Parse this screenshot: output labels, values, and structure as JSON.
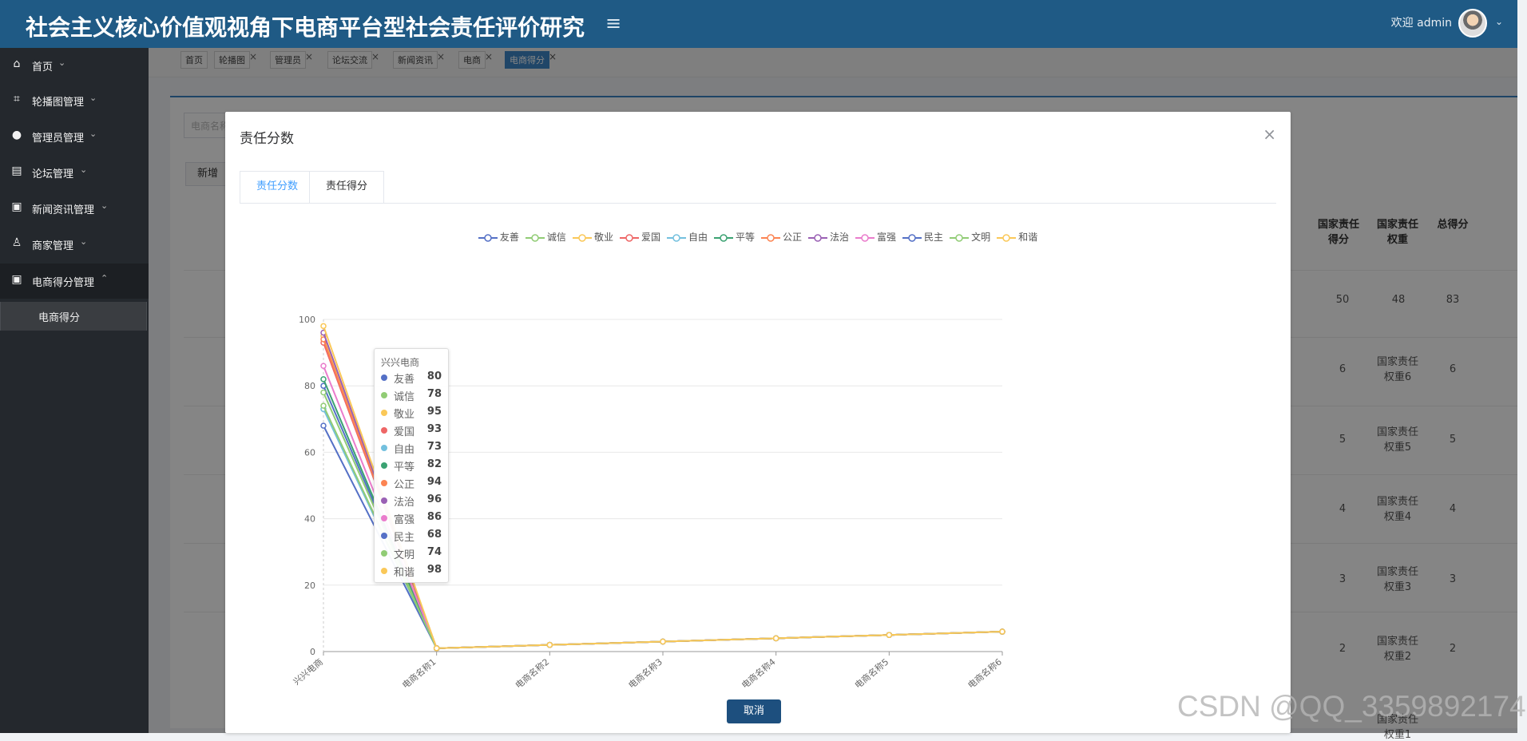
{
  "header": {
    "title": "社会主义核心价值观视角下电商平台型社会责任评价研究",
    "welcome": "欢迎 admin"
  },
  "sidebar": {
    "items": [
      {
        "label": "首页"
      },
      {
        "label": "轮播图管理"
      },
      {
        "label": "管理员管理"
      },
      {
        "label": "论坛管理"
      },
      {
        "label": "新闻资讯管理"
      },
      {
        "label": "商家管理"
      },
      {
        "label": "电商得分管理"
      }
    ],
    "subitem": "电商得分"
  },
  "tabs": [
    {
      "label": "首页"
    },
    {
      "label": "轮播图"
    },
    {
      "label": "管理员"
    },
    {
      "label": "论坛交流"
    },
    {
      "label": "新闻资讯"
    },
    {
      "label": "电商"
    },
    {
      "label": "电商得分"
    }
  ],
  "background": {
    "search_placeholder": "电商名称",
    "new_button": "新增",
    "headers": [
      "国家责任得分",
      "国家责任权重",
      "总得分"
    ],
    "rows": [
      {
        "score": "50",
        "weight": "48",
        "total": "83"
      },
      {
        "score": "6",
        "weight": "国家责任权重6",
        "total": "6"
      },
      {
        "score": "5",
        "weight": "国家责任权重5",
        "total": "5"
      },
      {
        "score": "4",
        "weight": "国家责任权重4",
        "total": "4"
      },
      {
        "score": "3",
        "weight": "国家责任权重3",
        "total": "3"
      },
      {
        "score": "2",
        "weight": "国家责任权重2",
        "total": "2"
      },
      {
        "score": "",
        "weight": "国家责任权重1",
        "total": ""
      }
    ]
  },
  "dialog": {
    "title": "责任分数",
    "tabs": [
      "责任分数",
      "责任得分"
    ],
    "cancel": "取消"
  },
  "tooltip": {
    "title": "兴兴电商",
    "rows": [
      {
        "name": "友善",
        "value": "80",
        "color": "#5470c6"
      },
      {
        "name": "诚信",
        "value": "78",
        "color": "#91cc75"
      },
      {
        "name": "敬业",
        "value": "95",
        "color": "#fac858"
      },
      {
        "name": "爱国",
        "value": "93",
        "color": "#ee6666"
      },
      {
        "name": "自由",
        "value": "73",
        "color": "#73c0de"
      },
      {
        "name": "平等",
        "value": "82",
        "color": "#3ba272"
      },
      {
        "name": "公正",
        "value": "94",
        "color": "#fc8452"
      },
      {
        "name": "法治",
        "value": "96",
        "color": "#9a60b4"
      },
      {
        "name": "富强",
        "value": "86",
        "color": "#ea7ccc"
      },
      {
        "name": "民主",
        "value": "68",
        "color": "#5470c6"
      },
      {
        "name": "文明",
        "value": "74",
        "color": "#91cc75"
      },
      {
        "name": "和谐",
        "value": "98",
        "color": "#fac858"
      }
    ]
  },
  "watermark": "CSDN @QQ_3359892174",
  "chart_data": {
    "type": "line",
    "categories": [
      "兴兴电商",
      "电商名称1",
      "电商名称2",
      "电商名称3",
      "电商名称4",
      "电商名称5",
      "电商名称6"
    ],
    "ylim": [
      0,
      100
    ],
    "yticks": [
      0,
      20,
      40,
      60,
      80,
      100
    ],
    "series": [
      {
        "name": "友善",
        "color": "#5470c6",
        "values": [
          80,
          1,
          2,
          3,
          4,
          5,
          6
        ]
      },
      {
        "name": "诚信",
        "color": "#91cc75",
        "values": [
          78,
          1,
          2,
          3,
          4,
          5,
          6
        ]
      },
      {
        "name": "敬业",
        "color": "#fac858",
        "values": [
          95,
          1,
          2,
          3,
          4,
          5,
          6
        ]
      },
      {
        "name": "爱国",
        "color": "#ee6666",
        "values": [
          93,
          1,
          2,
          3,
          4,
          5,
          6
        ]
      },
      {
        "name": "自由",
        "color": "#73c0de",
        "values": [
          73,
          1,
          2,
          3,
          4,
          5,
          6
        ]
      },
      {
        "name": "平等",
        "color": "#3ba272",
        "values": [
          82,
          1,
          2,
          3,
          4,
          5,
          6
        ]
      },
      {
        "name": "公正",
        "color": "#fc8452",
        "values": [
          94,
          1,
          2,
          3,
          4,
          5,
          6
        ]
      },
      {
        "name": "法治",
        "color": "#9a60b4",
        "values": [
          96,
          1,
          2,
          3,
          4,
          5,
          6
        ]
      },
      {
        "name": "富强",
        "color": "#ea7ccc",
        "values": [
          86,
          1,
          2,
          3,
          4,
          5,
          6
        ]
      },
      {
        "name": "民主",
        "color": "#5470c6",
        "values": [
          68,
          1,
          2,
          3,
          4,
          5,
          6
        ]
      },
      {
        "name": "文明",
        "color": "#91cc75",
        "values": [
          74,
          1,
          2,
          3,
          4,
          5,
          6
        ]
      },
      {
        "name": "和谐",
        "color": "#fac858",
        "values": [
          98,
          1,
          2,
          3,
          4,
          5,
          6
        ]
      }
    ],
    "legend": "top-center",
    "grid": true
  }
}
